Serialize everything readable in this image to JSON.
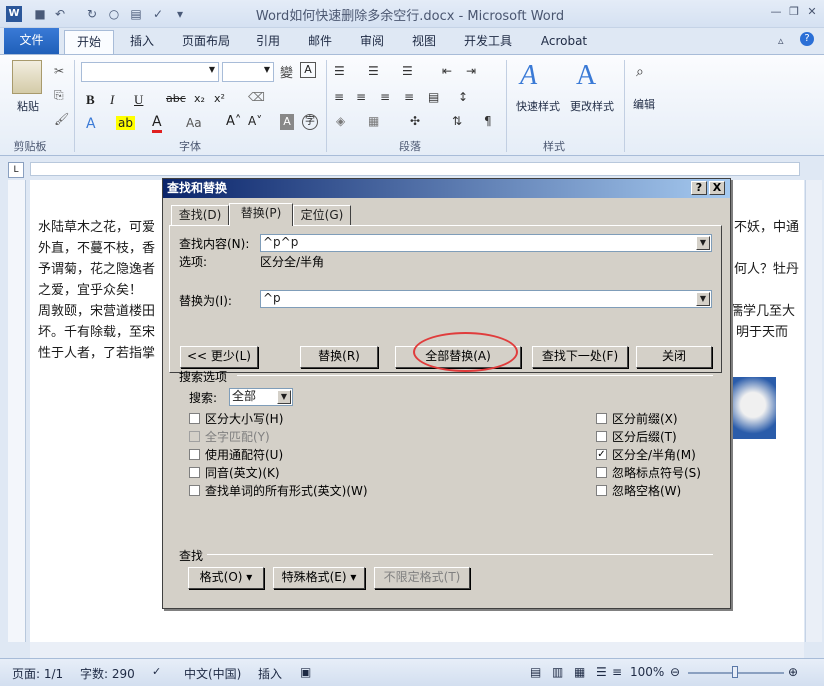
{
  "window": {
    "title": "Word如何快速删除多余空行.docx - Microsoft Word",
    "logo": "W"
  },
  "tabs": [
    "文件",
    "开始",
    "插入",
    "页面布局",
    "引用",
    "邮件",
    "审阅",
    "视图",
    "开发工具",
    "Acrobat"
  ],
  "ribbon": {
    "groups": [
      "剪贴板",
      "字体",
      "段落",
      "样式"
    ],
    "paste": "粘贴",
    "quick_styles": "快速样式",
    "change_styles": "更改样式",
    "edit": "编辑"
  },
  "document": {
    "lines_left": [
      "水陆草木之花，可爱",
      "外直，不蔓不枝，香",
      "予谓菊，花之隐逸者",
      "之爱，宜乎众矣！",
      "周敦颐，宋营道楼田",
      "坏。千有除载，至宋",
      "性于人者，了若指掌"
    ],
    "lines_right": [
      "不妖，中通",
      "何人？牡丹",
      "",
      "",
      "儒学几至大",
      "明于天而",
      ""
    ]
  },
  "dialog": {
    "title": "查找和替换",
    "help": "?",
    "close": "X",
    "tabs": [
      "查找(D)",
      "替换(P)",
      "定位(G)"
    ],
    "find_label": "查找内容(N):",
    "find_value": "^p^p",
    "options_label": "选项:",
    "options_value": "区分全/半角",
    "replace_label": "替换为(I):",
    "replace_value": "^p",
    "buttons": {
      "less": "<< 更少(L)",
      "replace": "替换(R)",
      "replace_all": "全部替换(A)",
      "find_next": "查找下一处(F)",
      "close": "关闭"
    },
    "search_options": "搜索选项",
    "search_label": "搜索:",
    "search_value": "全部",
    "left_options": [
      {
        "label": "区分大小写(H)",
        "checked": false,
        "disabled": false
      },
      {
        "label": "全字匹配(Y)",
        "checked": false,
        "disabled": true
      },
      {
        "label": "使用通配符(U)",
        "checked": false,
        "disabled": false
      },
      {
        "label": "同音(英文)(K)",
        "checked": false,
        "disabled": false
      },
      {
        "label": "查找单词的所有形式(英文)(W)",
        "checked": false,
        "disabled": false
      }
    ],
    "right_options": [
      {
        "label": "区分前缀(X)",
        "checked": false
      },
      {
        "label": "区分后缀(T)",
        "checked": false
      },
      {
        "label": "区分全/半角(M)",
        "checked": true
      },
      {
        "label": "忽略标点符号(S)",
        "checked": false
      },
      {
        "label": "忽略空格(W)",
        "checked": false
      }
    ],
    "find_section": "查找",
    "format_btn": "格式(O) ▾",
    "special_btn": "特殊格式(E) ▾",
    "noformat_btn": "不限定格式(T)"
  },
  "statusbar": {
    "page": "页面: 1/1",
    "words": "字数: 290",
    "lang": "中文(中国)",
    "insert": "插入",
    "zoom": "100%"
  }
}
